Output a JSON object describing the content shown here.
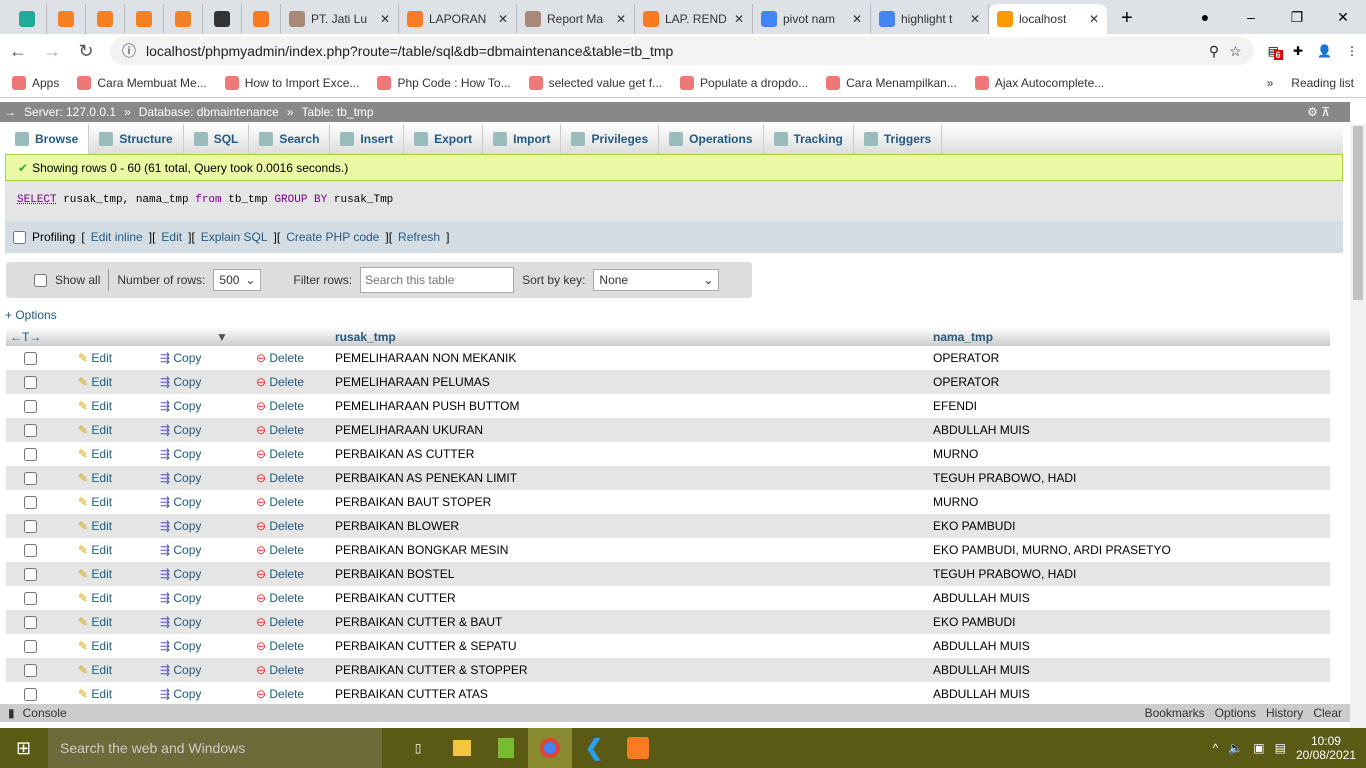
{
  "browser": {
    "tabs": [
      {
        "label": "",
        "icon": "#2a9"
      },
      {
        "label": "",
        "icon": "#f48024"
      },
      {
        "label": "",
        "icon": "#f48024"
      },
      {
        "label": "",
        "icon": "#f48024"
      },
      {
        "label": "",
        "icon": "#f48024"
      },
      {
        "label": "",
        "icon": "#333"
      },
      {
        "label": "",
        "icon": "#fb7a24"
      },
      {
        "label": "PT. Jati Lu",
        "icon": "#a87"
      },
      {
        "label": "LAPORAN",
        "icon": "#fb7a24"
      },
      {
        "label": "Report Ma",
        "icon": "#a87"
      },
      {
        "label": "LAP. REND",
        "icon": "#fb7a24"
      },
      {
        "label": "pivot nam",
        "icon": "#4285f4"
      },
      {
        "label": "highlight t",
        "icon": "#4285f4"
      },
      {
        "label": "localhost",
        "icon": "#f90"
      }
    ],
    "url": "localhost/phpmyadmin/index.php?route=/table/sql&db=dbmaintenance&table=tb_tmp",
    "extension_badge": "6",
    "bookmarks": [
      "Apps",
      "Cara Membuat Me...",
      "How to Import Exce...",
      "Php Code : How To...",
      "selected value get f...",
      "Populate a dropdo...",
      "Cara Menampilkan...",
      "Ajax Autocomplete..."
    ],
    "reading_list": "Reading list"
  },
  "breadcrumb": {
    "server": "Server: 127.0.0.1",
    "database": "Database: dbmaintenance",
    "table": "Table: tb_tmp"
  },
  "menu": [
    "Browse",
    "Structure",
    "SQL",
    "Search",
    "Insert",
    "Export",
    "Import",
    "Privileges",
    "Operations",
    "Tracking",
    "Triggers"
  ],
  "message": "Showing rows 0 - 60 (61 total, Query took 0.0016 seconds.)",
  "sql": {
    "select": "SELECT",
    "rest1": " rusak_tmp, nama_tmp ",
    "from": "from",
    "rest2": " tb_tmp ",
    "group": "GROUP BY",
    "rest3": " rusak_Tmp"
  },
  "profiling": {
    "label": "Profiling",
    "links": [
      "Edit inline",
      "Edit",
      "Explain SQL",
      "Create PHP code",
      "Refresh"
    ]
  },
  "nav": {
    "show_all": "Show all",
    "num_rows_label": "Number of rows:",
    "num_rows": "500",
    "filter_label": "Filter rows:",
    "filter_placeholder": "Search this table",
    "sort_label": "Sort by key:",
    "sort_value": "None"
  },
  "options": "+ Options",
  "table": {
    "columns": [
      "rusak_tmp",
      "nama_tmp"
    ],
    "actions": {
      "edit": "Edit",
      "copy": "Copy",
      "delete": "Delete"
    },
    "rows": [
      [
        "PEMELIHARAAN NON MEKANIK",
        "OPERATOR"
      ],
      [
        "PEMELIHARAAN PELUMAS",
        "OPERATOR"
      ],
      [
        "PEMELIHARAAN PUSH BUTTOM",
        "EFENDI"
      ],
      [
        "PEMELIHARAAN UKURAN",
        "ABDULLAH MUIS"
      ],
      [
        "PERBAIKAN AS CUTTER",
        "MURNO"
      ],
      [
        "PERBAIKAN AS PENEKAN LIMIT",
        "TEGUH PRABOWO, HADI"
      ],
      [
        "PERBAIKAN BAUT STOPER",
        "MURNO"
      ],
      [
        "PERBAIKAN BLOWER",
        "EKO PAMBUDI"
      ],
      [
        "PERBAIKAN BONGKAR MESIN",
        "EKO PAMBUDI, MURNO, ARDI PRASETYO"
      ],
      [
        "PERBAIKAN BOSTEL",
        "TEGUH PRABOWO, HADI"
      ],
      [
        "PERBAIKAN CUTTER",
        "ABDULLAH MUIS"
      ],
      [
        "PERBAIKAN CUTTER & BAUT",
        "EKO PAMBUDI"
      ],
      [
        "PERBAIKAN CUTTER & SEPATU",
        "ABDULLAH MUIS"
      ],
      [
        "PERBAIKAN CUTTER & STOPPER",
        "ABDULLAH MUIS"
      ],
      [
        "PERBAIKAN CUTTER ATAS",
        "ABDULLAH MUIS"
      ]
    ]
  },
  "console": {
    "label": "Console",
    "links": [
      "Bookmarks",
      "Options",
      "History",
      "Clear"
    ]
  },
  "taskbar": {
    "search": "Search the web and Windows",
    "time": "10:09",
    "date": "20/08/2021"
  }
}
